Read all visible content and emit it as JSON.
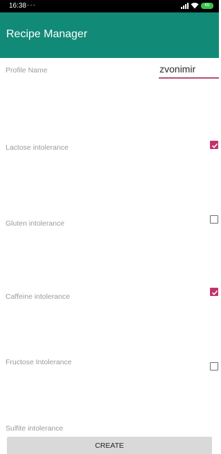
{
  "status_bar": {
    "time": "16:38",
    "dots": "···",
    "battery": "65"
  },
  "app_bar": {
    "title": "Recipe Manager",
    "color": "#128a78"
  },
  "profile": {
    "label": "Profile Name",
    "value": "zvonimir"
  },
  "intolerances": [
    {
      "label": "Lactose intolerance",
      "checked": true
    },
    {
      "label": "Gluten intolerance",
      "checked": false
    },
    {
      "label": "Caffeine intolerance",
      "checked": true
    },
    {
      "label": "Fructose Intolerance",
      "checked": false
    },
    {
      "label": "Sulfite intolerance",
      "checked": false
    }
  ],
  "create_button": {
    "label": "CREATE"
  },
  "colors": {
    "accent": "#c2336c",
    "primary": "#128a78"
  }
}
